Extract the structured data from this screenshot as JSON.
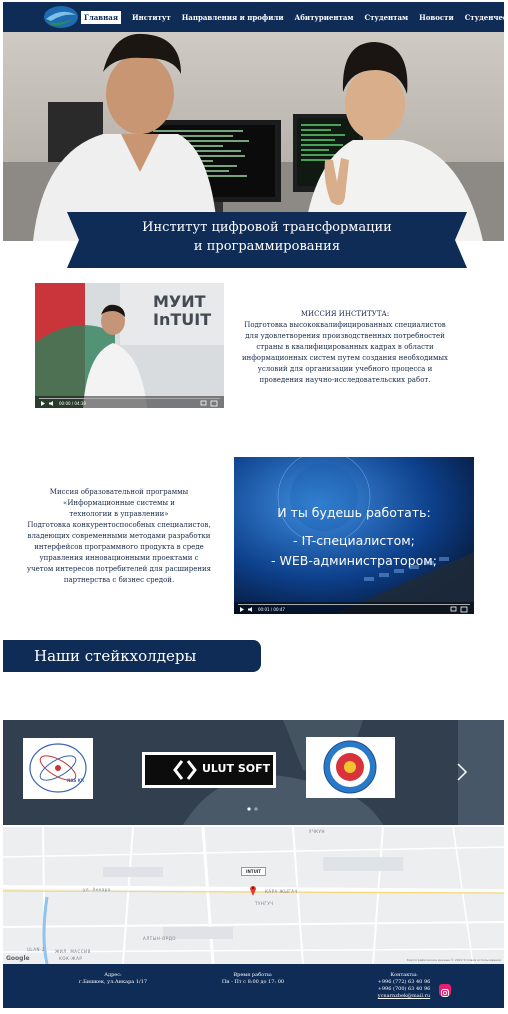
{
  "nav": {
    "items": [
      "Главная",
      "Институт",
      "Направления и профили",
      "Абитуриентам",
      "Студентам",
      "Новости",
      "Студенческая жизнь"
    ]
  },
  "hero": {
    "title_line1": "Институт цифровой трансформации",
    "title_line2": "и программирования"
  },
  "video1": {
    "sign_line1": "МУИТ",
    "sign_line2": "InTUIT",
    "time": "00:00 / 04:39"
  },
  "mission": {
    "heading": "МИССИЯ ИНСТИТУТА:",
    "lines": [
      "Подготовка высококвалифицированных специалистов",
      "для удовлетворения производственных потребностей",
      "страны в квалифицированных кадрах в области",
      "информационных систем путем создания необходимых",
      "условий для организации учебного процесса и",
      "проведения научно-исследовательских работ."
    ]
  },
  "program": {
    "lines": [
      "Миссия образовательной программы",
      "«Информационные системы и",
      "технологии в управлении»",
      "Подготовка конкурентоспособных специалистов,",
      "владеющих современными методами разработки",
      "интерфейсов программного продукта в среде",
      "управления инновационными проектами с",
      "учетом интересов потребителей для расширения",
      "партнерства с бизнес средой."
    ]
  },
  "video2": {
    "line1": "И ты будешь работать:",
    "line2": "- IT-специалистом;",
    "line3": "- WEB-администратором;",
    "time": "00:01 / 00:47"
  },
  "stakeholders": {
    "title": "Наши стейкхолдеры",
    "partner1_label": "NAS KR",
    "partner2_label": "ULUT SOFT"
  },
  "map": {
    "pin_label": "INTUIT",
    "place_kara": "КАРА ЖЫГАЧ",
    "place_tunguch": "ТУНГУЧ",
    "place_altyn": "АЛТЫН-ОРДО",
    "place_ulan": "ULAN-2",
    "place_zhil": "ЖИЛ. МАССИВ",
    "place_kok": "КОК-ЖАР",
    "place_uchkun": "УЧКУН",
    "street_ankara": "ул. Анкара",
    "google": "Google",
    "attribution": "Картографические данные © 2020  Условия использования"
  },
  "footer": {
    "address_label": "Адрес:",
    "address": "г.Бишкек, ул.Анкара 1/17",
    "hours_label": "Время работы:",
    "hours": "Пн - Пт  с 8:00 до 17: 00",
    "contacts_label": "Контакты:",
    "phone1": "+996 (772) 63 40 96",
    "phone2": "+996 (700) 63 40 96",
    "email": "ycnarnzbek@mail.ru"
  },
  "colors": {
    "navy": "#0f2c57",
    "instagram": "#e4206f",
    "map_pin": "#e53935"
  },
  "icons": [
    "logo-icon",
    "play-icon",
    "volume-icon",
    "settings-icon",
    "fullscreen-icon",
    "next-arrow-icon",
    "map-pin-icon",
    "instagram-icon"
  ]
}
